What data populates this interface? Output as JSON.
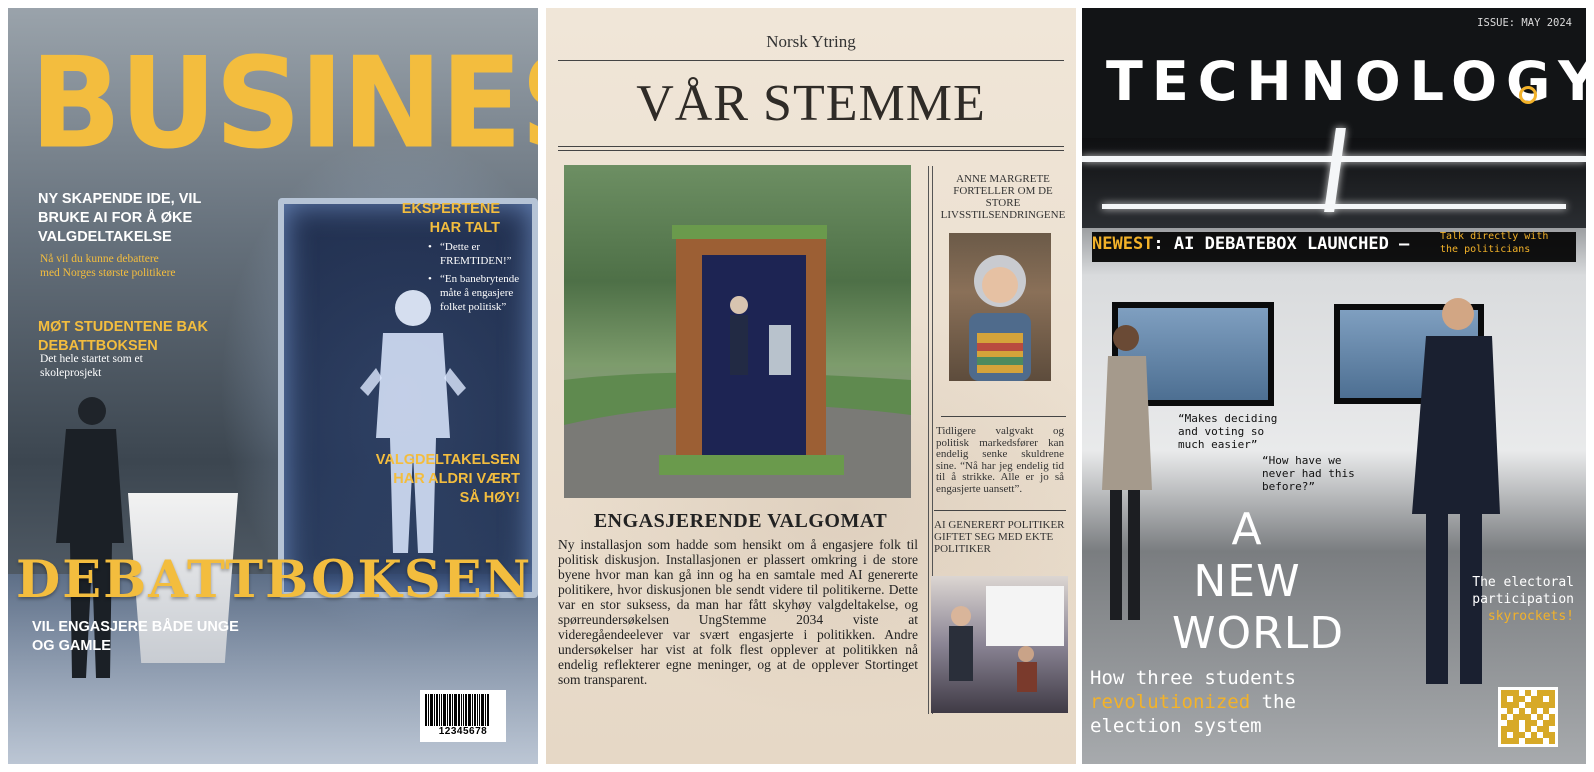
{
  "business": {
    "masthead": "BUSINESS",
    "headline1": "NY SKAPENDE IDE, VIL BRUKE AI FOR Å ØKE VALGDELTAKELSE",
    "sub1": "Nå vil du kunne debattere med Norges største politikere",
    "headline2": "MØT STUDENTENE BAK DEBATTBOKSEN",
    "sub2": "Det hele startet som et skoleprosjekt",
    "experts_heading": "EKSPERTENE HAR TALT",
    "quotes": [
      "“Dette er FREMTIDEN!”",
      "“En banebrytende måte å engasjere folket politisk”"
    ],
    "headline3": "VALGDELTAKELSEN HAR ALDRI VÆRT SÅ HØY!",
    "feature_title": "DEBATTBOKSEN",
    "tagline": "VIL ENGASJERE BÅDE UNGE OG GAMLE",
    "barcode_number": "12345678",
    "accent_color": "#f3bd3e"
  },
  "stemme": {
    "publication": "Norsk Ytring",
    "title": "VÅR STEMME",
    "side_heading1": "ANNE MARGRETE FORTELLER OM DE STORE LIVSSTILSENDRINGENE",
    "side_text": "Tidligere valgvakt og politisk markedsfører kan endelig senke skuldrene sine. “Nå har jeg endelig tid til å strikke. Alle er jo så engasjerte uansett”.",
    "side_heading2": "AI GENERERT POLITIKER GIFTET SEG MED EKTE POLITIKER",
    "headline": "ENGASJERENDE VALGOMAT",
    "body": "Ny installasjon som hadde som hensikt om å engasjere folk til politisk diskusjon. Installasjonen er plassert omkring i de store byene hvor man kan gå inn og ha en samtale med AI genererte politikere, hvor diskusjonen ble sendt videre til politikerne. Dette var en stor suksess, da man har fått skyhøy valgdeltakelse, og spørreundersøkelsen UngStemme 2034 viste at videregåendeelever var svært engasjerte i politikken. Andre undersøkelser har vist at folk flest opplever at politikken nå endelig reflekterer egne meninger, og at de opplever Stortinget som transparent."
  },
  "tech": {
    "issue": "ISSUE: MAY 2024",
    "title": "TECHNOLOGY",
    "banner_label": "NEWEST",
    "banner_text": ": AI DEBATEBOX LAUNCHED —",
    "banner_side": "Talk directly with the politicians",
    "quote1": "“Makes deciding and voting so much easier”",
    "quote2": "“How have we never had this before?”",
    "cover_line": "A NEW WORLD",
    "sub_part1": "How three students",
    "sub_highlight": "revolutionized",
    "sub_part2": "the election system",
    "right_line": "The electoral participation",
    "right_highlight": "skyrockets!",
    "accent_color": "#f3b229"
  }
}
